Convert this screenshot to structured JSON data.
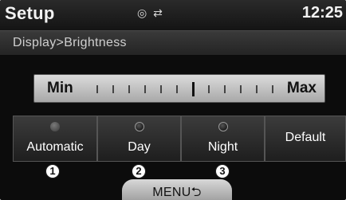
{
  "header": {
    "title": "Setup",
    "status_icons": [
      "disc-icon",
      "usb-icon"
    ],
    "clock": "12:25"
  },
  "breadcrumb": {
    "text": "Display>Brightness"
  },
  "brightness": {
    "min_label": "Min",
    "max_label": "Max",
    "level_fraction": 0.5
  },
  "modes": [
    {
      "label": "Automatic",
      "led": "off",
      "callout": "1"
    },
    {
      "label": "Day",
      "led": "dark",
      "callout": "2"
    },
    {
      "label": "Night",
      "led": "dark",
      "callout": "3"
    },
    {
      "label": "Default"
    }
  ],
  "menu": {
    "label": "MENU⮌"
  }
}
